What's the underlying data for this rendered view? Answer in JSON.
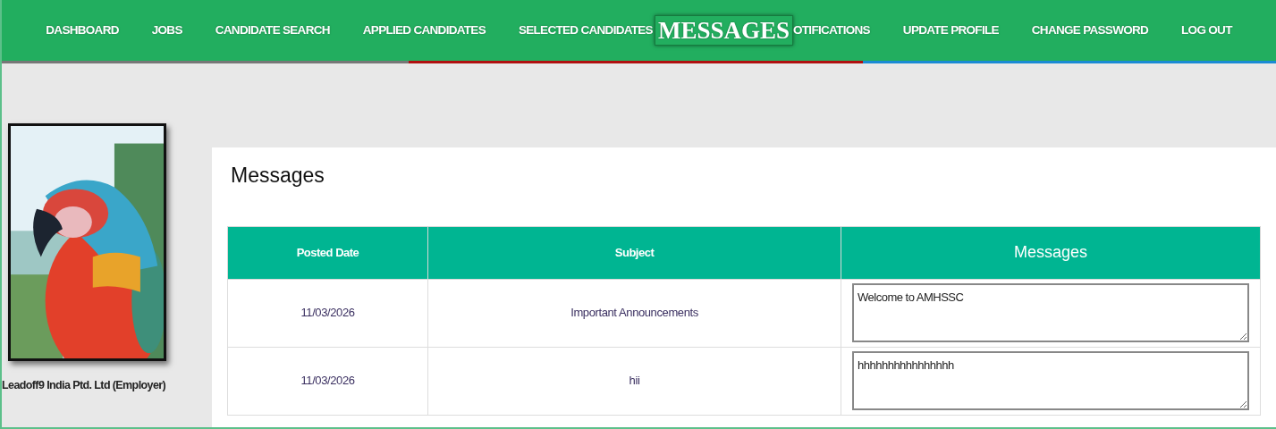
{
  "nav": {
    "items": [
      {
        "label": "DASHBOARD",
        "selected": false
      },
      {
        "label": "JOBS",
        "selected": false
      },
      {
        "label": "CANDIDATE SEARCH",
        "selected": false
      },
      {
        "label": "APPLIED CANDIDATES",
        "selected": false
      },
      {
        "label": "SELECTED CANDIDATES",
        "selected": false
      },
      {
        "label": "MESSAGES",
        "selected": true
      },
      {
        "label": "OTIFICATIONS",
        "selected": false
      },
      {
        "label": "UPDATE PROFILE",
        "selected": false
      },
      {
        "label": "CHANGE PASSWORD",
        "selected": false
      },
      {
        "label": "LOG OUT",
        "selected": false
      }
    ]
  },
  "profile": {
    "caption": "Leadoff9 India Ptd. Ltd (Employer)"
  },
  "page_title": "Messages",
  "table": {
    "columns": [
      "Posted Date",
      "Subject",
      "Messages"
    ],
    "rows": [
      {
        "posted_date": "11/03/2026",
        "subject": "Important Announcements",
        "message": "Welcome to AMHSSC"
      },
      {
        "posted_date": "11/03/2026",
        "subject": "hii",
        "message": "hhhhhhhhhhhhhhhh"
      }
    ]
  }
}
